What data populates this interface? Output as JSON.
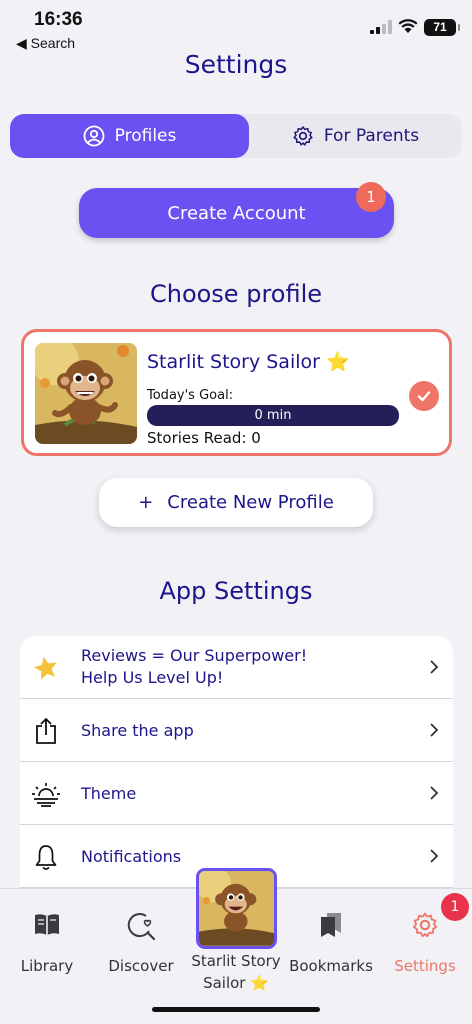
{
  "status": {
    "time": "16:36",
    "back_label": "◀ Search",
    "battery": "71"
  },
  "header": {
    "title": "Settings"
  },
  "segments": {
    "active_label": "Profiles",
    "inactive_label": "For Parents"
  },
  "create_account": {
    "label": "Create Account",
    "badge": "1"
  },
  "choose_profile": {
    "title": "Choose profile"
  },
  "profile": {
    "name": "Starlit Story Sailor ⭐",
    "goal_label": "Today's Goal:",
    "goal_value": "0 min",
    "goal_progress": 0,
    "stories_read": "Stories Read: 0"
  },
  "new_profile": {
    "plus": "+",
    "label": "Create New Profile"
  },
  "app_settings": {
    "title": "App Settings",
    "rows": [
      {
        "icon": "star-icon",
        "line1": "Reviews = Our Superpower!",
        "line2": "Help Us Level Up!"
      },
      {
        "icon": "share-icon",
        "label": "Share the app"
      },
      {
        "icon": "sun-icon",
        "label": "Theme"
      },
      {
        "icon": "bell-icon",
        "label": "Notifications"
      }
    ]
  },
  "tabs": {
    "library": "Library",
    "discover": "Discover",
    "profile_line1": "Starlit Story",
    "profile_line2": "Sailor ⭐",
    "bookmarks": "Bookmarks",
    "settings": "Settings",
    "settings_badge": "1"
  },
  "colors": {
    "accent": "#6a52f2",
    "coral": "#ee7568",
    "navy": "#1d168a",
    "background": "#f2f1f6"
  }
}
